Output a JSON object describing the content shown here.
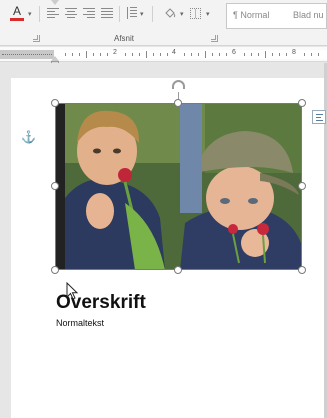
{
  "ribbon": {
    "font_color_letter": "A",
    "font_color_hex": "#d92b2b",
    "style_items": [
      "¶ Normal",
      "Blad nu"
    ],
    "group_label": "Afsnit",
    "icons": [
      "font-color-icon",
      "align-left-icon",
      "align-center-icon",
      "align-right-icon",
      "justify-icon",
      "line-spacing-icon",
      "shading-icon",
      "borders-icon",
      "dialog-launcher-icon"
    ]
  },
  "ruler": {
    "numbers": [
      "2",
      "4",
      "6",
      "8"
    ]
  },
  "document": {
    "heading": "Overskrift",
    "body": "Normaltekst",
    "image": "photo-two-boys-holding-radishes"
  },
  "colors": {
    "ribbon_bg": "#f3f3f3",
    "doc_bg": "#e6e6e6",
    "page_bg": "#ffffff",
    "accent": "#2e6fb5"
  }
}
